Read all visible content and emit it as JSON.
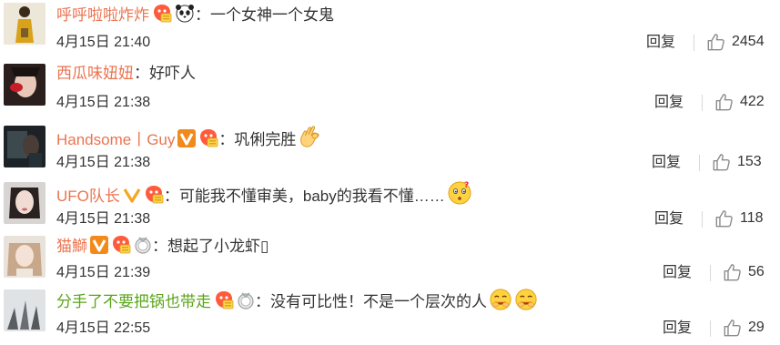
{
  "comments": [
    {
      "user": "呼呼啦啦炸炸",
      "sep": "：",
      "text": "一个女神一个女鬼",
      "time": "4月15日 21:40",
      "reply": "回复",
      "likes": "2454"
    },
    {
      "user": "西瓜味妞妞",
      "sep": "：",
      "text": "好吓人",
      "time": "4月15日 21:38",
      "reply": "回复",
      "likes": "422"
    },
    {
      "user": "Handsome丨Guy",
      "sep": "：",
      "text": "巩俐完胜",
      "time": "4月15日 21:38",
      "reply": "回复",
      "likes": "153"
    },
    {
      "user": "UFO队长",
      "sep": "：",
      "text": "可能我不懂审美，baby的我看不懂……",
      "time": "4月15日 21:38",
      "reply": "回复",
      "likes": "118"
    },
    {
      "user": "猫鰤",
      "sep": "：",
      "text": "想起了小龙虾▯",
      "time": "4月15日 21:39",
      "reply": "回复",
      "likes": "56"
    },
    {
      "user": "分手了不要把锅也带走",
      "sep": "：",
      "text": "没有可比性！不是一个层次的人",
      "time": "4月15日 22:55",
      "reply": "回复",
      "likes": "29"
    }
  ],
  "icons": {
    "vip": "vip-v-icon",
    "fan_badge": "fan-badge-icon",
    "medal": "silver-medal-icon",
    "like": "thumbs-up-icon"
  },
  "colors": {
    "username": "#eb7350",
    "username_green": "#5aa51a",
    "vip": "#f28a1b"
  }
}
